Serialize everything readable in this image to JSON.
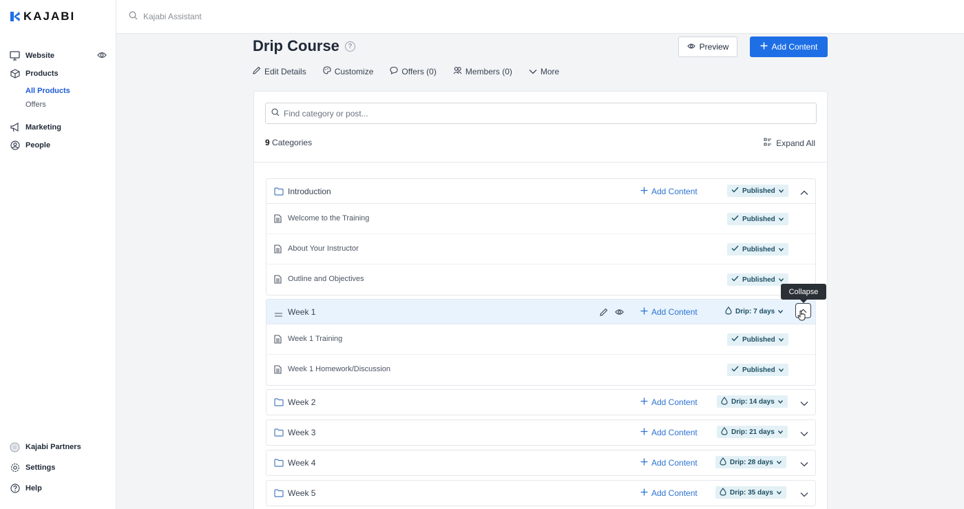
{
  "brand": {
    "name": "KAJABI"
  },
  "topbar": {
    "search_placeholder": "Kajabi Assistant"
  },
  "sidebar": {
    "items": [
      {
        "label": "Website",
        "icon": "monitor-icon"
      },
      {
        "label": "Products",
        "icon": "box-icon",
        "sub": [
          {
            "label": "All Products",
            "active": true
          },
          {
            "label": "Offers",
            "active": false
          }
        ]
      },
      {
        "label": "Marketing",
        "icon": "megaphone-icon"
      },
      {
        "label": "People",
        "icon": "user-circle-icon"
      }
    ],
    "bottom": [
      {
        "label": "Kajabi Partners",
        "icon": "partners-icon"
      },
      {
        "label": "Settings",
        "icon": "gear-icon"
      },
      {
        "label": "Help",
        "icon": "help-icon"
      }
    ]
  },
  "header": {
    "title": "Drip Course",
    "help_glyph": "?",
    "preview_label": "Preview",
    "add_content_label": "Add Content",
    "tabs": [
      {
        "label": "Edit Details",
        "icon": "pencil-icon"
      },
      {
        "label": "Customize",
        "icon": "palette-icon"
      },
      {
        "label": "Offers (0)",
        "icon": "chat-bubble-icon"
      },
      {
        "label": "Members (0)",
        "icon": "users-icon"
      },
      {
        "label": "More",
        "icon": "chevron-down-icon"
      }
    ]
  },
  "content": {
    "search_placeholder": "Find category or post...",
    "category_count": "9",
    "category_count_label": "Categories",
    "expand_all_label": "Expand All",
    "add_content_label": "Add Content",
    "categories": [
      {
        "title": "Introduction",
        "status": "Published",
        "status_type": "published",
        "expanded": true,
        "posts": [
          {
            "title": "Welcome to the Training",
            "status": "Published"
          },
          {
            "title": "About Your Instructor",
            "status": "Published"
          },
          {
            "title": "Outline and Objectives",
            "status": "Published"
          }
        ]
      },
      {
        "title": "Week 1",
        "status": "Drip: 7 days",
        "status_type": "drip",
        "expanded": true,
        "highlighted": true,
        "posts": [
          {
            "title": "Week 1 Training",
            "status": "Published"
          },
          {
            "title": "Week 1 Homework/Discussion",
            "status": "Published"
          }
        ]
      },
      {
        "title": "Week 2",
        "status": "Drip: 14 days",
        "status_type": "drip",
        "expanded": false
      },
      {
        "title": "Week 3",
        "status": "Drip: 21 days",
        "status_type": "drip",
        "expanded": false
      },
      {
        "title": "Week 4",
        "status": "Drip: 28 days",
        "status_type": "drip",
        "expanded": false
      },
      {
        "title": "Week 5",
        "status": "Drip: 35 days",
        "status_type": "drip",
        "expanded": false
      }
    ]
  },
  "tooltip": {
    "label": "Collapse"
  },
  "colors": {
    "accent": "#1e6fe6",
    "link": "#2c73d2",
    "badge_bg": "#e3f1f6",
    "badge_text": "#1d4e63",
    "highlight_row": "#e8f3fd"
  }
}
